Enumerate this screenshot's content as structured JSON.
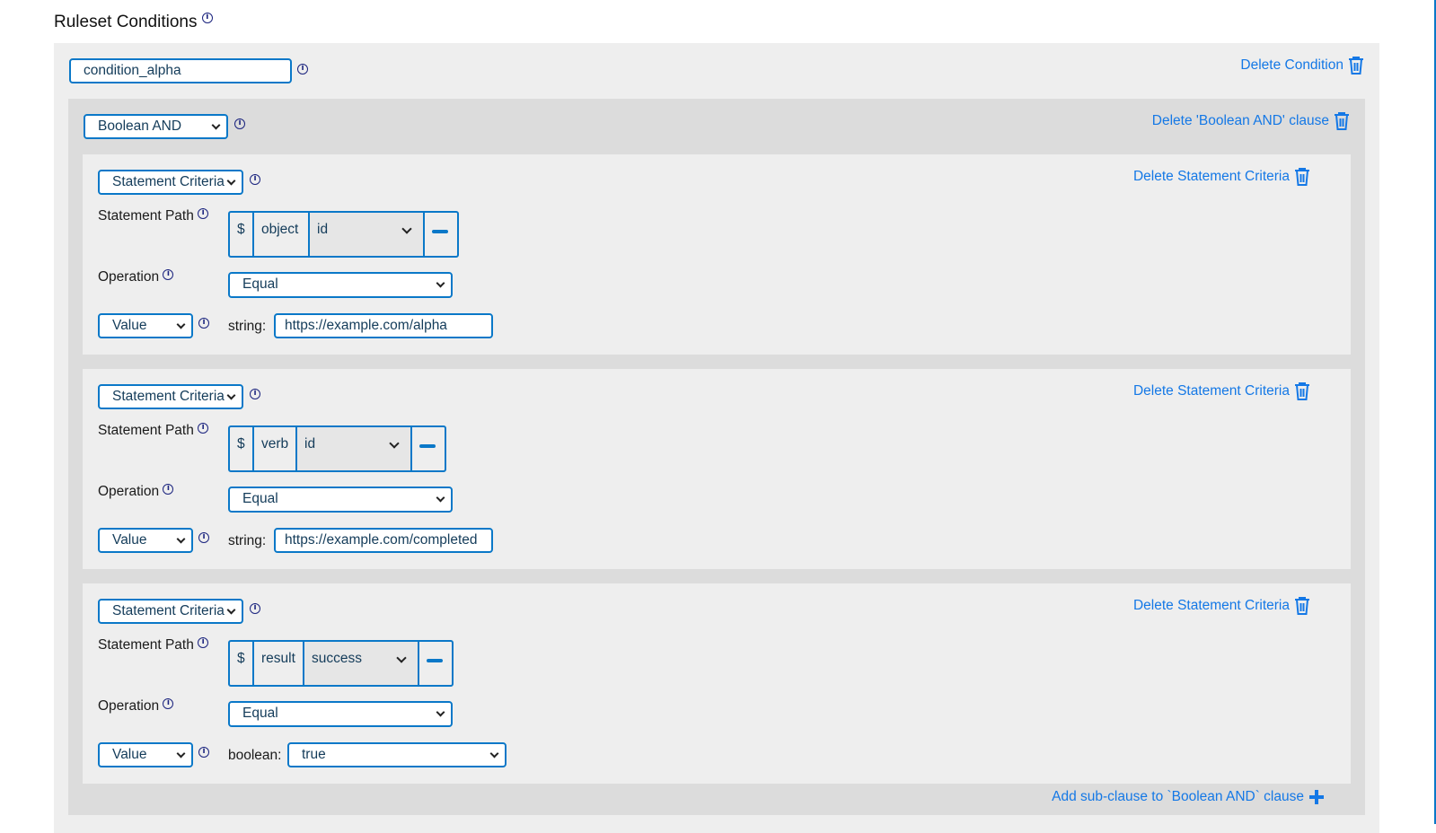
{
  "header": {
    "title": "Ruleset Conditions"
  },
  "condition": {
    "name": "condition_alpha",
    "delete_label": "Delete Condition"
  },
  "clause": {
    "type": "Boolean AND",
    "delete_label": "Delete 'Boolean AND' clause",
    "add_label": "Add sub-clause to `Boolean AND` clause"
  },
  "labels": {
    "statement_path": "Statement Path",
    "operation": "Operation",
    "dollar": "$"
  },
  "criteria": [
    {
      "type": "Statement Criteria",
      "delete_label": "Delete Statement Criteria",
      "path_segment": "object",
      "path_field": "id",
      "operation": "Equal",
      "value_kind": "Value",
      "value_type_label": "string:",
      "value": "https://example.com/alpha"
    },
    {
      "type": "Statement Criteria",
      "delete_label": "Delete Statement Criteria",
      "path_segment": "verb",
      "path_field": "id",
      "operation": "Equal",
      "value_kind": "Value",
      "value_type_label": "string:",
      "value": "https://example.com/completed"
    },
    {
      "type": "Statement Criteria",
      "delete_label": "Delete Statement Criteria",
      "path_segment": "result",
      "path_field": "success",
      "operation": "Equal",
      "value_kind": "Value",
      "value_type_label": "boolean:",
      "value": "true"
    }
  ],
  "colors": {
    "accent": "#0a78c8",
    "link": "#1478e6",
    "outer_bg": "#eeeeee",
    "inner_bg": "#dcdcdc"
  }
}
